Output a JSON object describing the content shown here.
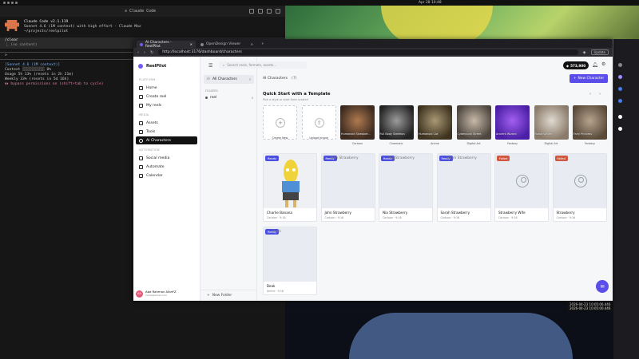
{
  "desktop": {
    "clock": "Apr 28 10:48",
    "window_title": "≡ Claude Code"
  },
  "terminal": {
    "header_line1": "Claude Code v2.1.119",
    "header_line2": "Sonnet 4.6 (1M context) with high effort · Claude Max",
    "header_line3": "~/projects/reelpilot",
    "cmd": "/clear",
    "cmd_out": "⎿  (no content)",
    "prompt": ">",
    "status1": "[Sonnet 4.6 (1M context)]",
    "status2": "Context ░░░░░░░░░░ 0%",
    "status3": "Usage 5h 13% (resets in 2h 21m)",
    "status4": "Weekly 33% (resets in 5d 16h)",
    "status5": "⏵⏵ bypass permissions on (shift+tab to cycle)"
  },
  "browser": {
    "tabs": [
      {
        "label": "AI Characters - ReelPilot"
      },
      {
        "label": "OpenDesign Viewer"
      }
    ],
    "url": "http://localhost:3176/dashboard/characters",
    "update": "Update"
  },
  "sidebar": {
    "brand": "ReelPilot",
    "sections": [
      {
        "title": "PLATFORM",
        "items": [
          "Home",
          "Create reel",
          "My reels"
        ]
      },
      {
        "title": "MEDIA",
        "items": [
          "Assets",
          "Tools",
          "AI Characters"
        ]
      },
      {
        "title": "AUTOMATION",
        "items": [
          "Social media",
          "Automate",
          "Calendar"
        ]
      }
    ],
    "user_initials": "AA",
    "user_name": "Abd Rahman Alkaf'Z",
    "user_email": "name@email.com"
  },
  "folders": {
    "all_label": "All Characters",
    "all_count": "7",
    "heading": "FOLDERS",
    "items": [
      {
        "name": "reel",
        "count": "0"
      }
    ],
    "new_folder": "New Folder"
  },
  "main": {
    "search_placeholder": "Search reels, formats, assets...",
    "credits": "573,900",
    "title": "AI Characters",
    "count": "(7)",
    "new_button": "New Character",
    "qs_title": "Quick Start with a Template",
    "qs_desc": "Pick a style or start from scratch",
    "templates": [
      {
        "label": "Create New",
        "kind": "new"
      },
      {
        "label": "Upload Image",
        "kind": "upload"
      },
      {
        "name": "Humanoid Strawber...",
        "cat": "Cartoon",
        "c1": "#3a2a20",
        "c2": "#b07a4f"
      },
      {
        "name": "Full Body Skeleton",
        "cat": "Cinematic",
        "c1": "#222222",
        "c2": "#9b9b9b"
      },
      {
        "name": "Humanoid Cat",
        "cat": "Anime",
        "c1": "#3e3320",
        "c2": "#a99874"
      },
      {
        "name": "Cyberpunk Street",
        "cat": "Digital Art",
        "c1": "#4d463f",
        "c2": "#c8b9a8"
      },
      {
        "name": "Ancient Wizard",
        "cat": "Fantasy",
        "c1": "#4a1fa6",
        "c2": "#a35ff0"
      },
      {
        "name": "Robot Waiter",
        "cat": "Digital Art",
        "c1": "#8a7a6a",
        "c2": "#e0dad0"
      },
      {
        "name": "Fairy Princess",
        "cat": "Fantasy",
        "c1": "#5a4a3a",
        "c2": "#b6a48e"
      }
    ],
    "characters": [
      {
        "status": "Ready",
        "name": "Charlie Banana",
        "meta": "Cartoon · 9:16",
        "img": "banana",
        "alt": ""
      },
      {
        "status": "Ready",
        "name": "John Strawberry",
        "meta": "Cartoon · 9:16",
        "img": "blank",
        "alt": "John Strawberry"
      },
      {
        "status": "Ready",
        "name": "Nia Strawberry",
        "meta": "Cartoon · 9:16",
        "img": "blank",
        "alt": "Nia Strawberry"
      },
      {
        "status": "Ready",
        "name": "Sarah Strawberry",
        "meta": "Cartoon · 9:16",
        "img": "blank",
        "alt": "Sarah Strawberry"
      },
      {
        "status": "Failed",
        "name": "Strawberry Wife",
        "meta": "Cartoon · 9:16",
        "img": "placeholder",
        "alt": ""
      },
      {
        "status": "Failed",
        "name": "Strawberry",
        "meta": "Cartoon · 9:16",
        "img": "placeholder",
        "alt": ""
      },
      {
        "status": "Ready",
        "name": "Beak",
        "meta": "Anime · 9:16",
        "img": "blank",
        "alt": "Beak"
      }
    ]
  },
  "logs": {
    "line1": "2026-04-23 10:05:06.446",
    "line2": "2026-04-23 10:05:00.446"
  },
  "colors": {
    "accent": "#5b4dea",
    "failed": "#d0573d",
    "ready": "#4b4fe0"
  }
}
